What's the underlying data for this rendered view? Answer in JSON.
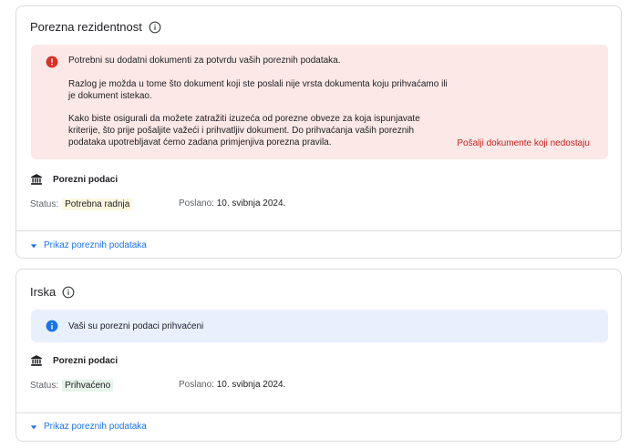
{
  "residency": {
    "title": "Porezna rezidentnost",
    "alert": {
      "p1": "Potrebni su dodatni dokumenti za potvrdu vaših poreznih podataka.",
      "p2": "Razlog je možda u tome što dokument koji ste poslali nije vrsta dokumenta koju prihvaćamo ili je dokument istekao.",
      "p3": "Kako biste osigurali da možete zatražiti izuzeća od porezne obveze za koja ispunjavate kriterije, što prije pošaljite važeći i prihvatljiv dokument. Do prihvaćanja vaših poreznih podataka upotrebljavat ćemo zadana primjenjiva porezna pravila.",
      "link": "Pošalji dokumente koji nedostaju"
    },
    "section_title": "Porezni podaci",
    "status_label": "Status:",
    "status_value": "Potrebna radnja",
    "sent_label": "Poslano:",
    "sent_value": "10. svibnja 2024.",
    "toggle_label": "Prikaz poreznih podataka"
  },
  "ireland": {
    "title": "Irska",
    "alert": {
      "text": "Vaši su porezni podaci prihvaćeni"
    },
    "section_title": "Porezni podaci",
    "status_label": "Status:",
    "status_value": "Prihvaćeno",
    "sent_label": "Poslano:",
    "sent_value": "10. svibnja 2024.",
    "toggle_label": "Prikaz poreznih podataka"
  },
  "colors": {
    "error": "#d93025",
    "error_bg": "#fce8e6",
    "info": "#1a73e8",
    "info_bg": "#e8f0fe",
    "link": "#1a73e8",
    "error_link": "#c5221f"
  },
  "icons": {
    "info": "info-outline-icon",
    "error": "error-filled-icon",
    "bank": "bank-icon",
    "caret": "caret-down-icon"
  }
}
